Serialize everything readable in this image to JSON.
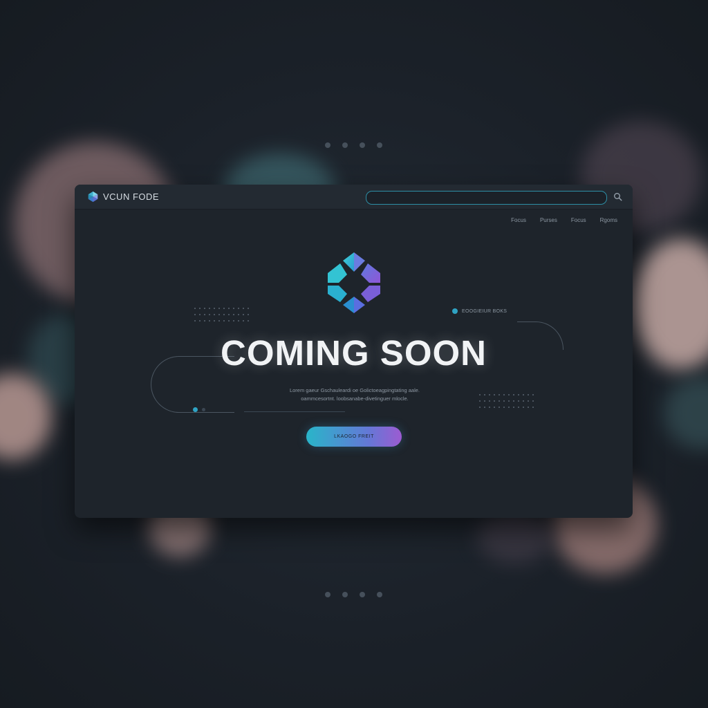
{
  "header": {
    "brand_name": "VCUN FODE",
    "search": {
      "value": "",
      "placeholder": ""
    },
    "nav": [
      "Focus",
      "Purses",
      "Focus",
      "Rgoms"
    ]
  },
  "hero": {
    "logo_icon": "hexagon-logo-icon",
    "tag_text": "EOOGIEIUR BOKS",
    "headline": "COMING SOON",
    "subtitle_line1": "Lorem  gaeur  Gschauleardi  oe  Golictoeagpingtating  aale.",
    "subtitle_line2": "oammcesortnt.  loobsanabe-divetinguer  mlocle.",
    "cta_label": "LKAOGO  FREIT"
  },
  "colors": {
    "accent_teal": "#2fa3c3",
    "accent_purple": "#9c5bd1",
    "background": "#1b2129",
    "window": "#1e242b",
    "headline": "#f1f3f5"
  }
}
